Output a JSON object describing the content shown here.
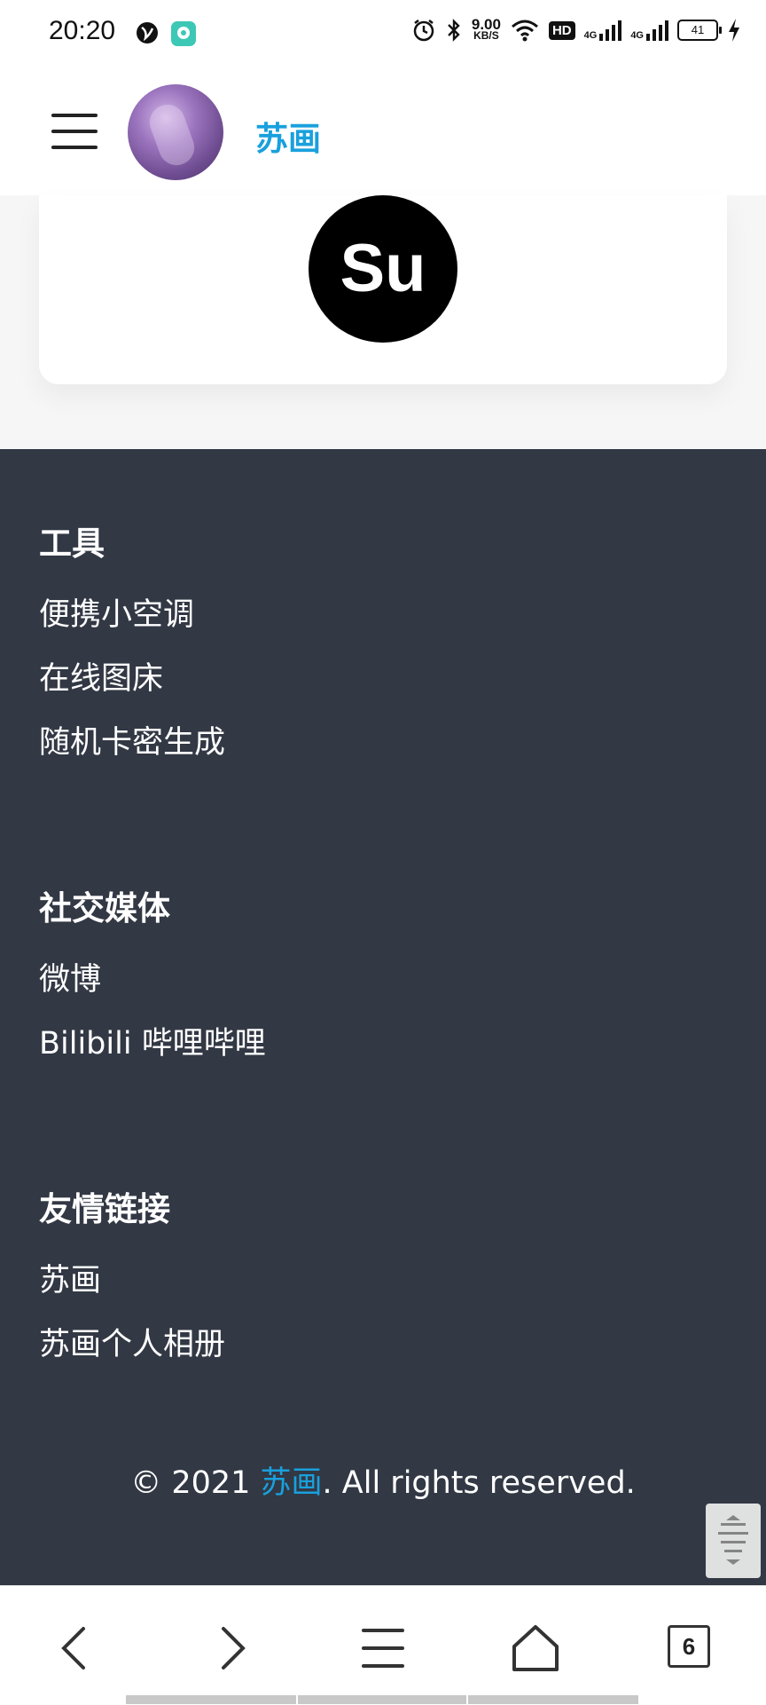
{
  "status_bar": {
    "time": "20:20",
    "net_speed": "9.00",
    "net_unit": "KB/S",
    "hd": "HD",
    "signal1": "4G",
    "signal2": "4G",
    "battery": "41"
  },
  "header": {
    "site_name": "苏画",
    "menu_icon": "hamburger-icon",
    "avatar": "avatar-image"
  },
  "profile": {
    "logo_text": "Su"
  },
  "footer": {
    "sections": [
      {
        "title": "工具",
        "links": [
          "便携小空调",
          "在线图床",
          "随机卡密生成"
        ]
      },
      {
        "title": "社交媒体",
        "links": [
          "微博",
          "Bilibili 哔哩哔哩"
        ]
      },
      {
        "title": "友情链接",
        "links": [
          "苏画",
          "苏画个人相册"
        ]
      }
    ],
    "copyright_prefix": "© 2021 ",
    "copyright_name": "苏画",
    "copyright_suffix": ". All rights reserved."
  },
  "browser_bar": {
    "tab_count": "6",
    "icons": [
      "back-icon",
      "forward-icon",
      "menu-icon",
      "home-icon",
      "tabs-icon"
    ]
  },
  "colors": {
    "accent": "#19a0dd",
    "footer_bg": "#323844"
  }
}
